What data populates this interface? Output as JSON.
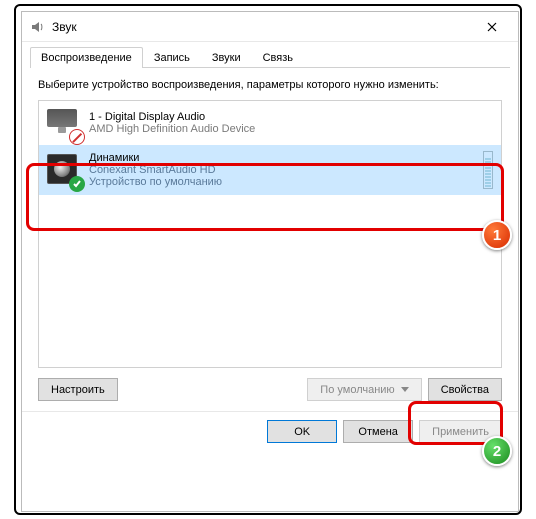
{
  "window": {
    "title": "Звук"
  },
  "tabs": [
    {
      "label": "Воспроизведение",
      "active": true
    },
    {
      "label": "Запись",
      "active": false
    },
    {
      "label": "Звуки",
      "active": false
    },
    {
      "label": "Связь",
      "active": false
    }
  ],
  "instruction": "Выберите устройство воспроизведения, параметры которого нужно изменить:",
  "devices": [
    {
      "name": "1 - Digital Display Audio",
      "driver": "AMD High Definition Audio Device",
      "status": "",
      "state": "disabled",
      "selected": false
    },
    {
      "name": "Динамики",
      "driver": "Conexant SmartAudio HD",
      "status": "Устройство по умолчанию",
      "state": "default",
      "selected": true
    }
  ],
  "buttons": {
    "configure": "Настроить",
    "set_default": "По умолчанию",
    "properties": "Свойства",
    "ok": "OK",
    "cancel": "Отмена",
    "apply": "Применить"
  },
  "callouts": {
    "one": "1",
    "two": "2"
  }
}
